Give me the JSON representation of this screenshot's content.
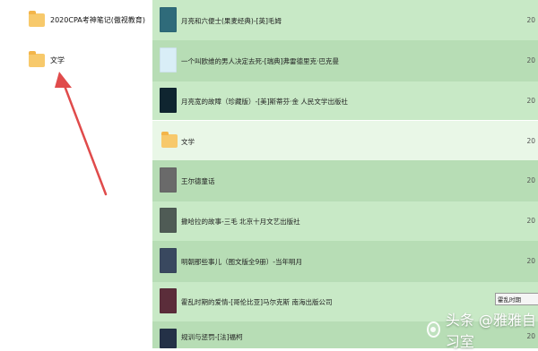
{
  "left_panel": {
    "items": [
      {
        "label": "2020CPA考神笔记(傲视教育)",
        "icon": "folder-icon"
      },
      {
        "label": "文学",
        "icon": "folder-icon"
      }
    ]
  },
  "right_panel": {
    "rows": [
      {
        "title": "月亮和六便士(果麦经典)-[英]毛姆",
        "year": "20",
        "thumb_color": "#2f6b7a",
        "type": "book"
      },
      {
        "title": "一个叫欧维的男人决定去死-[瑞典]弗雷德里克·巴克曼",
        "year": "20",
        "thumb_color": "#d9eef7",
        "type": "book"
      },
      {
        "title": "月亮宽的故障（珍藏版）-[美]斯蒂芬·金 人民文学出版社",
        "year": "20",
        "thumb_color": "#0f2530",
        "type": "book"
      },
      {
        "title": "文学",
        "year": "20",
        "thumb_color": "#f7c96b",
        "type": "folder"
      },
      {
        "title": "王尔德童话",
        "year": "20",
        "thumb_color": "#6a6a6a",
        "type": "book"
      },
      {
        "title": "撒哈拉的故事-三毛 北京十月文艺出版社",
        "year": "20",
        "thumb_color": "#4f5b55",
        "type": "book"
      },
      {
        "title": "明朝那些事儿（图文版全9册）-当年明月",
        "year": "20",
        "thumb_color": "#39485f",
        "type": "book"
      },
      {
        "title": "霍乱时期的爱情-[哥伦比亚]马尔克斯  南海出版公司",
        "year": "20",
        "thumb_color": "#5b2d3a",
        "type": "book"
      },
      {
        "title": "规训与惩罚-[法]福柯",
        "year": "20",
        "thumb_color": "#243147",
        "type": "book"
      }
    ]
  },
  "tooltip": {
    "text": "霍乱时期"
  },
  "watermark": {
    "text": "头条 @雅雅自习室"
  },
  "colors": {
    "green": "#c8e9c6",
    "green_alt": "#b7ddb5",
    "highlight": "#e9f7e7",
    "arrow": "#e04b4b"
  }
}
